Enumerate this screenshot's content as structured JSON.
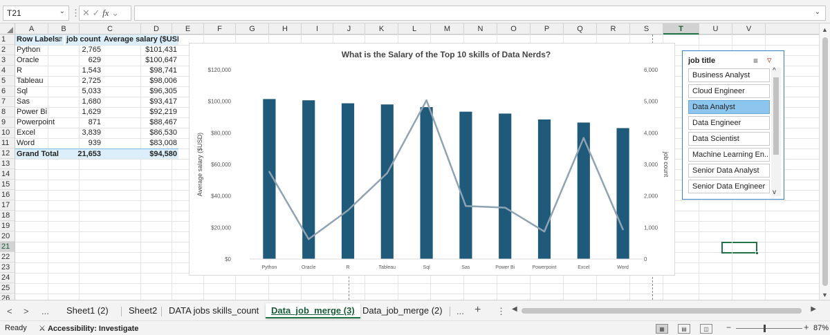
{
  "formula_bar": {
    "name_box": "T21",
    "name_box_dropdown_icon": "chevron-down-icon",
    "options_icon": "vertical-ellipsis-icon",
    "cancel_icon": "✕",
    "enter_icon": "✓",
    "fx_label": "fx",
    "formula": "",
    "expand_icon": "chevron-down-icon"
  },
  "columns": [
    "A",
    "B",
    "C",
    "D",
    "E",
    "F",
    "G",
    "H",
    "I",
    "J",
    "K",
    "L",
    "M",
    "N",
    "O",
    "P",
    "Q",
    "R",
    "S",
    "T",
    "U",
    "V"
  ],
  "selected_column": "T",
  "rows": [
    "1",
    "2",
    "3",
    "4",
    "5",
    "6",
    "7",
    "8",
    "9",
    "10",
    "11",
    "12",
    "13",
    "14",
    "15",
    "16",
    "17",
    "18",
    "19",
    "20",
    "21",
    "22",
    "23",
    "24",
    "25",
    "26"
  ],
  "selected_row": "21",
  "pivot": {
    "headers": [
      "Row Labels",
      "job count",
      "Average salary ($USD)"
    ],
    "filter_icon": "filter-sort-icon",
    "rows": [
      {
        "label": "Python",
        "count": "2,765",
        "salary": "$101,431"
      },
      {
        "label": "Oracle",
        "count": "629",
        "salary": "$100,647"
      },
      {
        "label": "R",
        "count": "1,543",
        "salary": "$98,741"
      },
      {
        "label": "Tableau",
        "count": "2,725",
        "salary": "$98,006"
      },
      {
        "label": "Sql",
        "count": "5,033",
        "salary": "$96,305"
      },
      {
        "label": "Sas",
        "count": "1,680",
        "salary": "$93,417"
      },
      {
        "label": "Power Bi",
        "count": "1,629",
        "salary": "$92,219"
      },
      {
        "label": "Powerpoint",
        "count": "871",
        "salary": "$88,467"
      },
      {
        "label": "Excel",
        "count": "3,839",
        "salary": "$86,530"
      },
      {
        "label": "Word",
        "count": "939",
        "salary": "$83,008"
      }
    ],
    "total": {
      "label": "Grand Total",
      "count": "21,653",
      "salary": "$94,580"
    }
  },
  "chart_data": {
    "type": "bar",
    "title": "What is the Salary of the Top 10 skills of Data Nerds?",
    "categories": [
      "Python",
      "Oracle",
      "R",
      "Tableau",
      "Sql",
      "Sas",
      "Power Bi",
      "Powerpoint",
      "Excel",
      "Word"
    ],
    "series": [
      {
        "type": "bar",
        "axis": "left",
        "values": [
          101431,
          100647,
          98741,
          98006,
          96305,
          93417,
          92219,
          88467,
          86530,
          83008
        ],
        "color": "#1f5a7a"
      },
      {
        "type": "line",
        "axis": "right",
        "values": [
          2765,
          629,
          1543,
          2725,
          5033,
          1680,
          1629,
          871,
          3839,
          939
        ],
        "color": "#8fa3b3"
      }
    ],
    "ylabel": "Average salary ($USD)",
    "y2label": "job count",
    "ylim": [
      0,
      120000
    ],
    "y2lim": [
      0,
      6000
    ],
    "yticks": [
      "$0",
      "$20,000",
      "$40,000",
      "$60,000",
      "$80,000",
      "$100,000",
      "$120,000"
    ],
    "y2ticks": [
      "0",
      "1,000",
      "2,000",
      "3,000",
      "4,000",
      "5,000",
      "6,000"
    ],
    "grid": false
  },
  "slicer": {
    "title": "job title",
    "multi_select_icon": "multi-select-icon",
    "clear_filter_icon": "clear-filter-icon",
    "items": [
      {
        "label": "Business Analyst",
        "selected": false
      },
      {
        "label": "Cloud Engineer",
        "selected": false
      },
      {
        "label": "Data Analyst",
        "selected": true
      },
      {
        "label": "Data Engineer",
        "selected": false
      },
      {
        "label": "Data Scientist",
        "selected": false
      },
      {
        "label": "Machine Learning En...",
        "selected": false
      },
      {
        "label": "Senior Data Analyst",
        "selected": false
      },
      {
        "label": "Senior Data Engineer",
        "selected": false
      }
    ],
    "scroll_up_icon": "^",
    "scroll_down_icon": "v"
  },
  "sheet_tabs": {
    "prev_icon": "<",
    "next_icon": ">",
    "more_left": "...",
    "tabs": [
      {
        "label": "Sheet1 (2)",
        "active": false
      },
      {
        "label": "Sheet2",
        "active": false
      },
      {
        "label": "DATA jobs skills_count",
        "active": false
      },
      {
        "label": "Data_job_merge (3)",
        "active": true
      },
      {
        "label": "Data_job_merge (2)",
        "active": false
      }
    ],
    "more_right": "...",
    "add_icon": "+",
    "options_icon": "⋮"
  },
  "status_bar": {
    "ready": "Ready",
    "accessibility_label": "Accessibility: Investigate",
    "zoom": "87%",
    "zoom_minus": "−",
    "zoom_plus": "+"
  }
}
